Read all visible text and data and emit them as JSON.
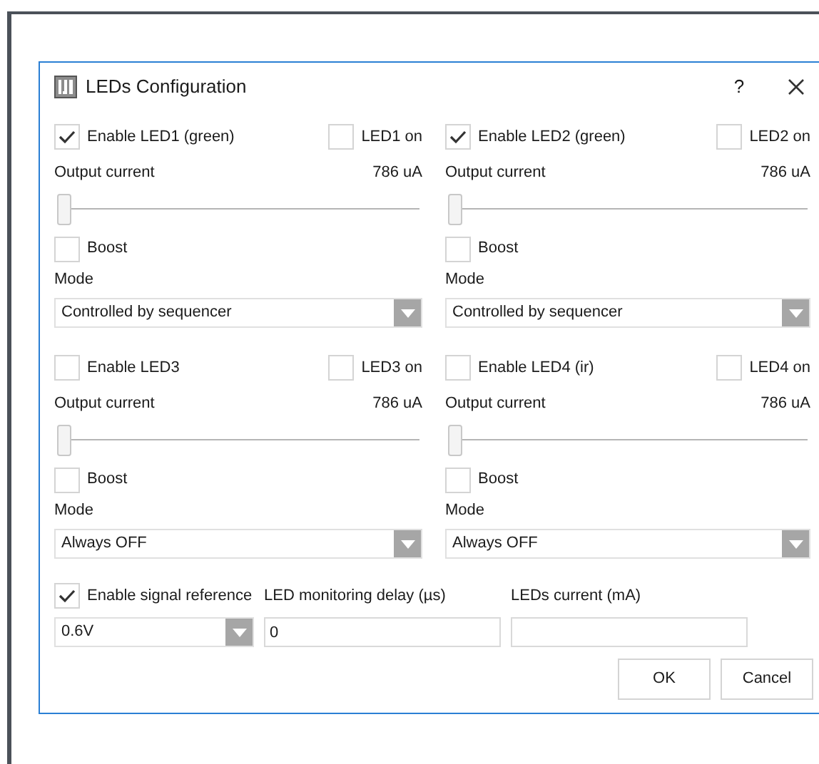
{
  "window": {
    "title": "LEDs Configuration",
    "help": "?"
  },
  "leds": [
    {
      "enable_label": "Enable LED1 (green)",
      "enabled": true,
      "on_label": "LED1 on",
      "on": false,
      "output_label": "Output current",
      "reading": "786 uA",
      "level": 0.0,
      "boost_label": "Boost",
      "boost": false,
      "mode_label": "Mode",
      "mode": "Controlled by sequencer"
    },
    {
      "enable_label": "Enable LED2 (green)",
      "enabled": true,
      "on_label": "LED2 on",
      "on": false,
      "output_label": "Output current",
      "reading": "786 uA",
      "level": 0.0,
      "boost_label": "Boost",
      "boost": false,
      "mode_label": "Mode",
      "mode": "Controlled by sequencer"
    },
    {
      "enable_label": "Enable LED3",
      "enabled": false,
      "on_label": "LED3 on",
      "on": false,
      "output_label": "Output current",
      "reading": "786 uA",
      "level": 0.0,
      "boost_label": "Boost",
      "boost": false,
      "mode_label": "Mode",
      "mode": "Always OFF"
    },
    {
      "enable_label": "Enable LED4 (ir)",
      "enabled": false,
      "on_label": "LED4 on",
      "on": false,
      "output_label": "Output current",
      "reading": "786 uA",
      "level": 0.0,
      "boost_label": "Boost",
      "boost": false,
      "mode_label": "Mode",
      "mode": "Always OFF"
    }
  ],
  "signal_reference": {
    "label": "Enable signal reference",
    "checked": true,
    "value": "0.6V"
  },
  "monitoring_delay": {
    "label": "LED monitoring delay (µs)",
    "value": "0"
  },
  "leds_current": {
    "label": "LEDs current (mA)"
  },
  "buttons": [
    "OK",
    "Cancel"
  ]
}
